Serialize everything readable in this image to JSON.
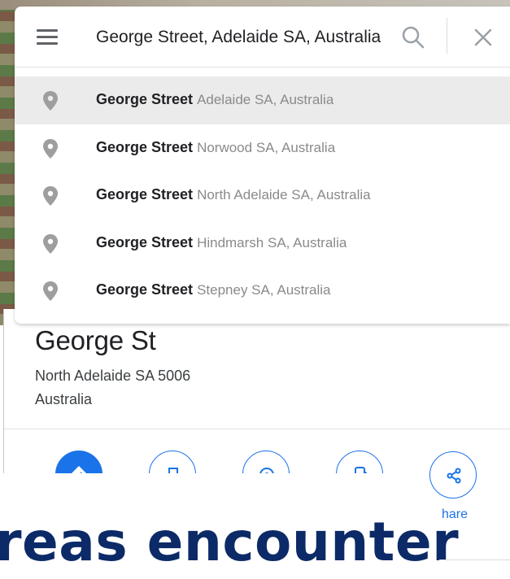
{
  "search": {
    "value": "George Street, Adelaide SA, Australia",
    "suggestions": [
      {
        "main": "George Street",
        "secondary": "Adelaide SA, Australia"
      },
      {
        "main": "George Street",
        "secondary": "Norwood SA, Australia"
      },
      {
        "main": "George Street",
        "secondary": "North Adelaide SA, Australia"
      },
      {
        "main": "George Street",
        "secondary": "Hindmarsh SA, Australia"
      },
      {
        "main": "George Street",
        "secondary": "Stepney SA, Australia"
      }
    ]
  },
  "place": {
    "title": "George St",
    "address_line1": "North Adelaide SA 5006",
    "address_line2": "Australia"
  },
  "actions": {
    "share_label": "hare"
  },
  "overlay": {
    "headline": "reas encounter"
  },
  "colors": {
    "accent": "#1a73e8",
    "headline": "#0b2a67",
    "active_row": "#ebebeb"
  }
}
